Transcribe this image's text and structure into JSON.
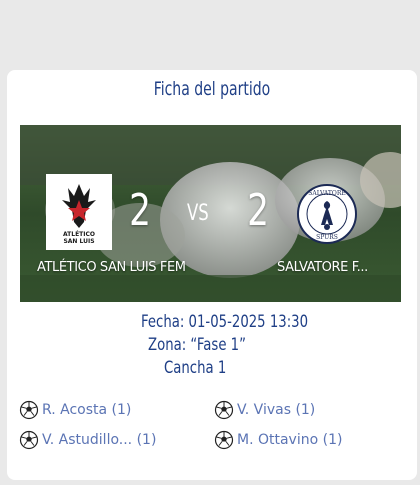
{
  "card": {
    "title": "Ficha del partido"
  },
  "match": {
    "home_team": "ATLÉTICO SAN LUIS FEM",
    "away_team": "SALVATORE F...",
    "home_score": "2",
    "away_score": "2",
    "vs_label": "VS",
    "home_logo_text": [
      "ATLÉTICO",
      "SAN LUIS"
    ],
    "away_logo_text": [
      "SALVATORE",
      "SPURS"
    ]
  },
  "info": {
    "date": "Fecha: 01-05-2025 13:30",
    "zone": "Zona: “Fase 1”",
    "field": "Cancha 1"
  },
  "scorers": {
    "home": [
      {
        "label": "R. Acosta (1)",
        "icon": "soccer-ball-icon"
      },
      {
        "label": "V. Astudillo... (1)",
        "icon": "soccer-ball-icon"
      }
    ],
    "away": [
      {
        "label": "V. Vivas (1)",
        "icon": "soccer-ball-icon"
      },
      {
        "label": "M. Ottavino (1)",
        "icon": "soccer-ball-icon"
      }
    ]
  },
  "colors": {
    "title": "#1f3f86",
    "scorer_text": "#5b74b4",
    "page_bg": "#e9e9e9"
  }
}
